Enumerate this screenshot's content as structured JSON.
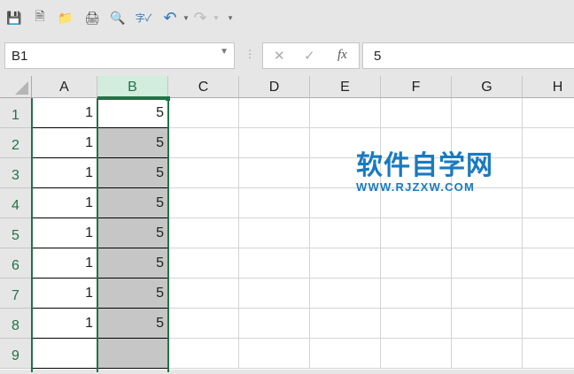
{
  "toolbar": {
    "icons": [
      "save-icon",
      "new-file-icon",
      "open-folder-icon",
      "print-icon",
      "print-preview-icon",
      "spell-check-icon",
      "undo-icon",
      "redo-icon",
      "customize-icon"
    ]
  },
  "formula_bar": {
    "name_box": "B1",
    "value": "5",
    "fx_label": "fx"
  },
  "columns": [
    "A",
    "B",
    "C",
    "D",
    "E",
    "F",
    "G",
    "H"
  ],
  "selected_column": "B",
  "rows": [
    {
      "n": "1",
      "A": "1",
      "B": "5"
    },
    {
      "n": "2",
      "A": "1",
      "B": "5"
    },
    {
      "n": "3",
      "A": "1",
      "B": "5"
    },
    {
      "n": "4",
      "A": "1",
      "B": "5"
    },
    {
      "n": "5",
      "A": "1",
      "B": "5"
    },
    {
      "n": "6",
      "A": "1",
      "B": "5"
    },
    {
      "n": "7",
      "A": "1",
      "B": "5"
    },
    {
      "n": "8",
      "A": "1",
      "B": "5"
    },
    {
      "n": "9",
      "A": "",
      "B": ""
    }
  ],
  "watermark": {
    "title": "软件自学网",
    "url": "WWW.RJZXW.COM"
  },
  "colors": {
    "accent": "#217346",
    "selection_fill": "#c6c6c6"
  }
}
